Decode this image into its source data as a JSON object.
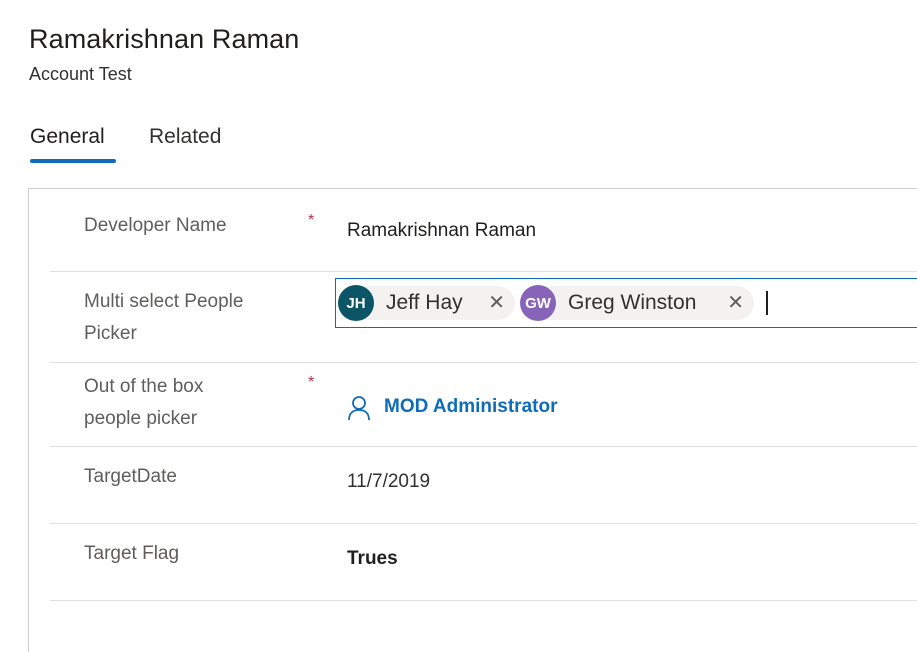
{
  "header": {
    "title": "Ramakrishnan Raman",
    "subtitle": "Account Test"
  },
  "tabs": [
    {
      "label": "General",
      "active": true
    },
    {
      "label": "Related",
      "active": false
    }
  ],
  "fields": {
    "developer_name": {
      "label": "Developer Name",
      "required": "*",
      "value": "Ramakrishnan Raman"
    },
    "multi_picker": {
      "label_line1": "Multi select People",
      "label_line2": "Picker",
      "people": [
        {
          "initials": "JH",
          "name": "Jeff Hay",
          "color": "#0b5566",
          "remove_icon": "close-icon"
        },
        {
          "initials": "GW",
          "name": "Greg Winston",
          "color": "#8764b8",
          "remove_icon": "close-icon"
        }
      ]
    },
    "ootb_picker": {
      "label_line1": "Out of the box",
      "label_line2": "people picker",
      "required": "*",
      "icon": "person-icon",
      "value": "MOD Administrator"
    },
    "target_date": {
      "label": "TargetDate",
      "value": "11/7/2019"
    },
    "target_flag": {
      "label": "Target Flag",
      "value": "Trues"
    }
  },
  "colors": {
    "accent": "#0f6cbd",
    "required": "#c4314b"
  }
}
